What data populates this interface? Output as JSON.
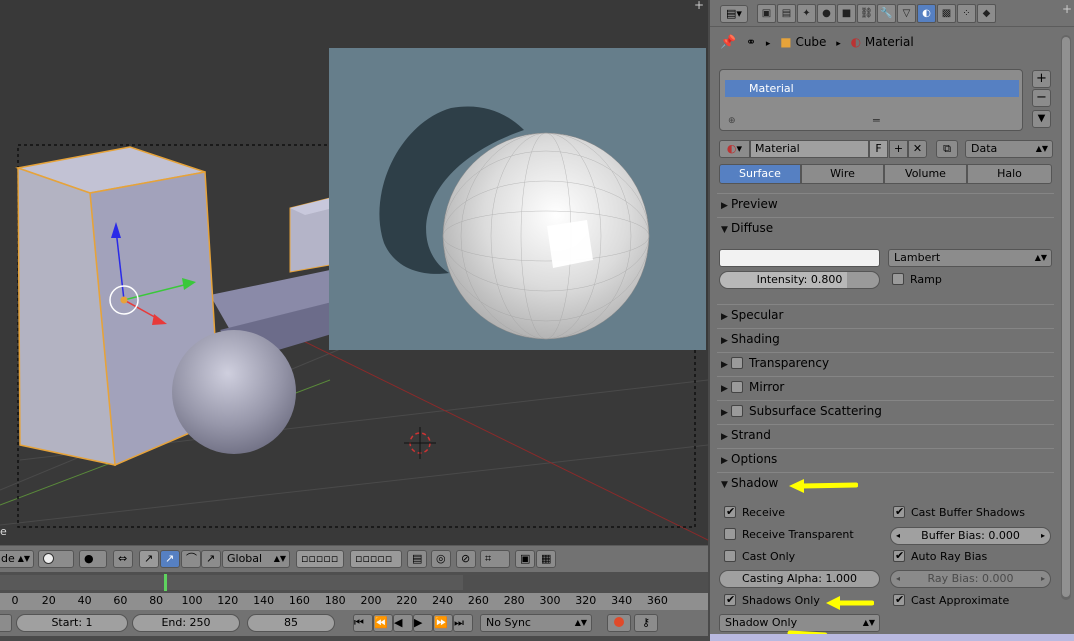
{
  "viewport": {
    "left_menu_fragment": "de",
    "corner_fragment": "e",
    "orientation": "Global"
  },
  "timeline": {
    "ticks": [
      "0",
      "20",
      "40",
      "60",
      "80",
      "100",
      "120",
      "140",
      "160",
      "180",
      "200",
      "220",
      "240",
      "260",
      "280",
      "300",
      "320",
      "340",
      "360"
    ],
    "start_label": "Start: 1",
    "end_label": "End: 250",
    "current_frame": "85",
    "sync": "No Sync"
  },
  "breadcrumb": {
    "object": "Cube",
    "material": "Material"
  },
  "slots": [
    "Material"
  ],
  "datablock": {
    "name": "Material",
    "fake_user": "F",
    "link": "Data"
  },
  "type_tabs": [
    "Surface",
    "Wire",
    "Volume",
    "Halo"
  ],
  "active_type_tab": "Surface",
  "panels": {
    "preview": "Preview",
    "diffuse": "Diffuse",
    "specular": "Specular",
    "shading": "Shading",
    "transparency": "Transparency",
    "mirror": "Mirror",
    "sss": "Subsurface Scattering",
    "strand": "Strand",
    "options": "Options",
    "shadow": "Shadow"
  },
  "diffuse": {
    "shader": "Lambert",
    "intensity": "Intensity: 0.800",
    "ramp": "Ramp",
    "color": "#f2f2f2"
  },
  "shadow": {
    "receive": "Receive",
    "receive_transparent": "Receive Transparent",
    "cast_only": "Cast Only",
    "casting_alpha": "Casting Alpha: 1.000",
    "shadows_only": "Shadows Only",
    "shadow_mode": "Shadow Only",
    "cast_buffer_shadows": "Cast Buffer Shadows",
    "buffer_bias": "Buffer Bias: 0.000",
    "auto_ray_bias": "Auto Ray Bias",
    "ray_bias": "Ray Bias: 0.000",
    "cast_approximate": "Cast Approximate"
  },
  "colors": {
    "accent": "#5680c2",
    "annotation": "#ffff00",
    "render_bg": "#667e8b"
  }
}
